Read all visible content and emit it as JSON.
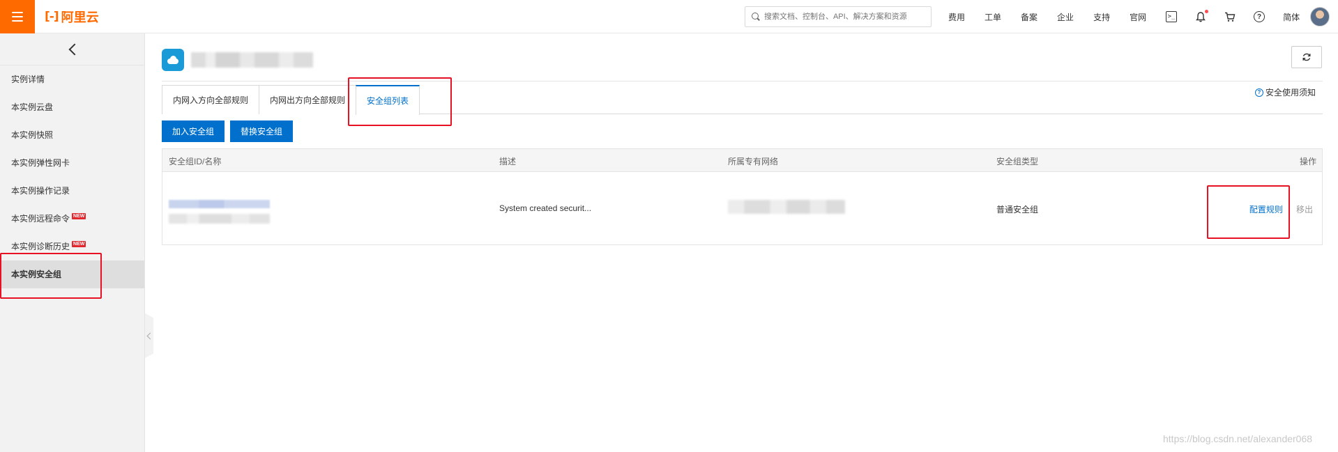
{
  "topbar": {
    "logo_text": "阿里云",
    "logo_mark": "[-]",
    "search_placeholder": "搜索文档、控制台、API、解决方案和资源",
    "nav": [
      "费用",
      "工单",
      "备案",
      "企业",
      "支持",
      "官网"
    ],
    "lang": "简体",
    "accent_color": "#ff6a00"
  },
  "sidebar": {
    "items": [
      {
        "label": "实例详情"
      },
      {
        "label": "本实例云盘"
      },
      {
        "label": "本实例快照"
      },
      {
        "label": "本实例弹性网卡"
      },
      {
        "label": "本实例操作记录"
      },
      {
        "label": "本实例远程命令",
        "badge": "NEW"
      },
      {
        "label": "本实例诊断历史",
        "badge": "NEW"
      },
      {
        "label": "本实例安全组",
        "active": true
      }
    ]
  },
  "main": {
    "tabs": [
      {
        "label": "内网入方向全部规则"
      },
      {
        "label": "内网出方向全部规则"
      },
      {
        "label": "安全组列表",
        "active": true
      }
    ],
    "safety_link": "安全使用须知",
    "buttons": {
      "add": "加入安全组",
      "replace": "替换安全组"
    },
    "table": {
      "columns": [
        "安全组ID/名称",
        "描述",
        "所属专有网络",
        "安全组类型",
        "操作"
      ],
      "rows": [
        {
          "description": "System created securit...",
          "type": "普通安全组",
          "actions": {
            "config": "配置规则",
            "separator": "|",
            "remove": "移出"
          }
        }
      ]
    }
  },
  "watermark": "https://blog.csdn.net/alexander068",
  "colors": {
    "primary_blue": "#0070cc",
    "annotation_red": "#e81123",
    "new_badge_red": "#e0282e"
  }
}
